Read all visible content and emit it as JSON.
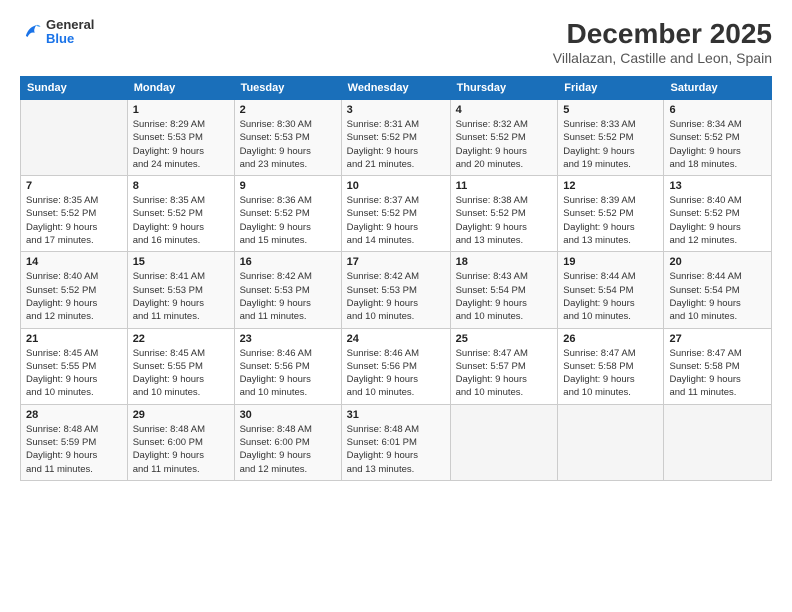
{
  "header": {
    "logo": {
      "general": "General",
      "blue": "Blue"
    },
    "title": "December 2025",
    "subtitle": "Villalazan, Castille and Leon, Spain"
  },
  "calendar": {
    "days_of_week": [
      "Sunday",
      "Monday",
      "Tuesday",
      "Wednesday",
      "Thursday",
      "Friday",
      "Saturday"
    ],
    "weeks": [
      [
        {
          "day": "",
          "info": ""
        },
        {
          "day": "1",
          "info": "Sunrise: 8:29 AM\nSunset: 5:53 PM\nDaylight: 9 hours\nand 24 minutes."
        },
        {
          "day": "2",
          "info": "Sunrise: 8:30 AM\nSunset: 5:53 PM\nDaylight: 9 hours\nand 23 minutes."
        },
        {
          "day": "3",
          "info": "Sunrise: 8:31 AM\nSunset: 5:52 PM\nDaylight: 9 hours\nand 21 minutes."
        },
        {
          "day": "4",
          "info": "Sunrise: 8:32 AM\nSunset: 5:52 PM\nDaylight: 9 hours\nand 20 minutes."
        },
        {
          "day": "5",
          "info": "Sunrise: 8:33 AM\nSunset: 5:52 PM\nDaylight: 9 hours\nand 19 minutes."
        },
        {
          "day": "6",
          "info": "Sunrise: 8:34 AM\nSunset: 5:52 PM\nDaylight: 9 hours\nand 18 minutes."
        }
      ],
      [
        {
          "day": "7",
          "info": "Sunrise: 8:35 AM\nSunset: 5:52 PM\nDaylight: 9 hours\nand 17 minutes."
        },
        {
          "day": "8",
          "info": "Sunrise: 8:35 AM\nSunset: 5:52 PM\nDaylight: 9 hours\nand 16 minutes."
        },
        {
          "day": "9",
          "info": "Sunrise: 8:36 AM\nSunset: 5:52 PM\nDaylight: 9 hours\nand 15 minutes."
        },
        {
          "day": "10",
          "info": "Sunrise: 8:37 AM\nSunset: 5:52 PM\nDaylight: 9 hours\nand 14 minutes."
        },
        {
          "day": "11",
          "info": "Sunrise: 8:38 AM\nSunset: 5:52 PM\nDaylight: 9 hours\nand 13 minutes."
        },
        {
          "day": "12",
          "info": "Sunrise: 8:39 AM\nSunset: 5:52 PM\nDaylight: 9 hours\nand 13 minutes."
        },
        {
          "day": "13",
          "info": "Sunrise: 8:40 AM\nSunset: 5:52 PM\nDaylight: 9 hours\nand 12 minutes."
        }
      ],
      [
        {
          "day": "14",
          "info": "Sunrise: 8:40 AM\nSunset: 5:52 PM\nDaylight: 9 hours\nand 12 minutes."
        },
        {
          "day": "15",
          "info": "Sunrise: 8:41 AM\nSunset: 5:53 PM\nDaylight: 9 hours\nand 11 minutes."
        },
        {
          "day": "16",
          "info": "Sunrise: 8:42 AM\nSunset: 5:53 PM\nDaylight: 9 hours\nand 11 minutes."
        },
        {
          "day": "17",
          "info": "Sunrise: 8:42 AM\nSunset: 5:53 PM\nDaylight: 9 hours\nand 10 minutes."
        },
        {
          "day": "18",
          "info": "Sunrise: 8:43 AM\nSunset: 5:54 PM\nDaylight: 9 hours\nand 10 minutes."
        },
        {
          "day": "19",
          "info": "Sunrise: 8:44 AM\nSunset: 5:54 PM\nDaylight: 9 hours\nand 10 minutes."
        },
        {
          "day": "20",
          "info": "Sunrise: 8:44 AM\nSunset: 5:54 PM\nDaylight: 9 hours\nand 10 minutes."
        }
      ],
      [
        {
          "day": "21",
          "info": "Sunrise: 8:45 AM\nSunset: 5:55 PM\nDaylight: 9 hours\nand 10 minutes."
        },
        {
          "day": "22",
          "info": "Sunrise: 8:45 AM\nSunset: 5:55 PM\nDaylight: 9 hours\nand 10 minutes."
        },
        {
          "day": "23",
          "info": "Sunrise: 8:46 AM\nSunset: 5:56 PM\nDaylight: 9 hours\nand 10 minutes."
        },
        {
          "day": "24",
          "info": "Sunrise: 8:46 AM\nSunset: 5:56 PM\nDaylight: 9 hours\nand 10 minutes."
        },
        {
          "day": "25",
          "info": "Sunrise: 8:47 AM\nSunset: 5:57 PM\nDaylight: 9 hours\nand 10 minutes."
        },
        {
          "day": "26",
          "info": "Sunrise: 8:47 AM\nSunset: 5:58 PM\nDaylight: 9 hours\nand 10 minutes."
        },
        {
          "day": "27",
          "info": "Sunrise: 8:47 AM\nSunset: 5:58 PM\nDaylight: 9 hours\nand 11 minutes."
        }
      ],
      [
        {
          "day": "28",
          "info": "Sunrise: 8:48 AM\nSunset: 5:59 PM\nDaylight: 9 hours\nand 11 minutes."
        },
        {
          "day": "29",
          "info": "Sunrise: 8:48 AM\nSunset: 6:00 PM\nDaylight: 9 hours\nand 11 minutes."
        },
        {
          "day": "30",
          "info": "Sunrise: 8:48 AM\nSunset: 6:00 PM\nDaylight: 9 hours\nand 12 minutes."
        },
        {
          "day": "31",
          "info": "Sunrise: 8:48 AM\nSunset: 6:01 PM\nDaylight: 9 hours\nand 13 minutes."
        },
        {
          "day": "",
          "info": ""
        },
        {
          "day": "",
          "info": ""
        },
        {
          "day": "",
          "info": ""
        }
      ]
    ]
  }
}
